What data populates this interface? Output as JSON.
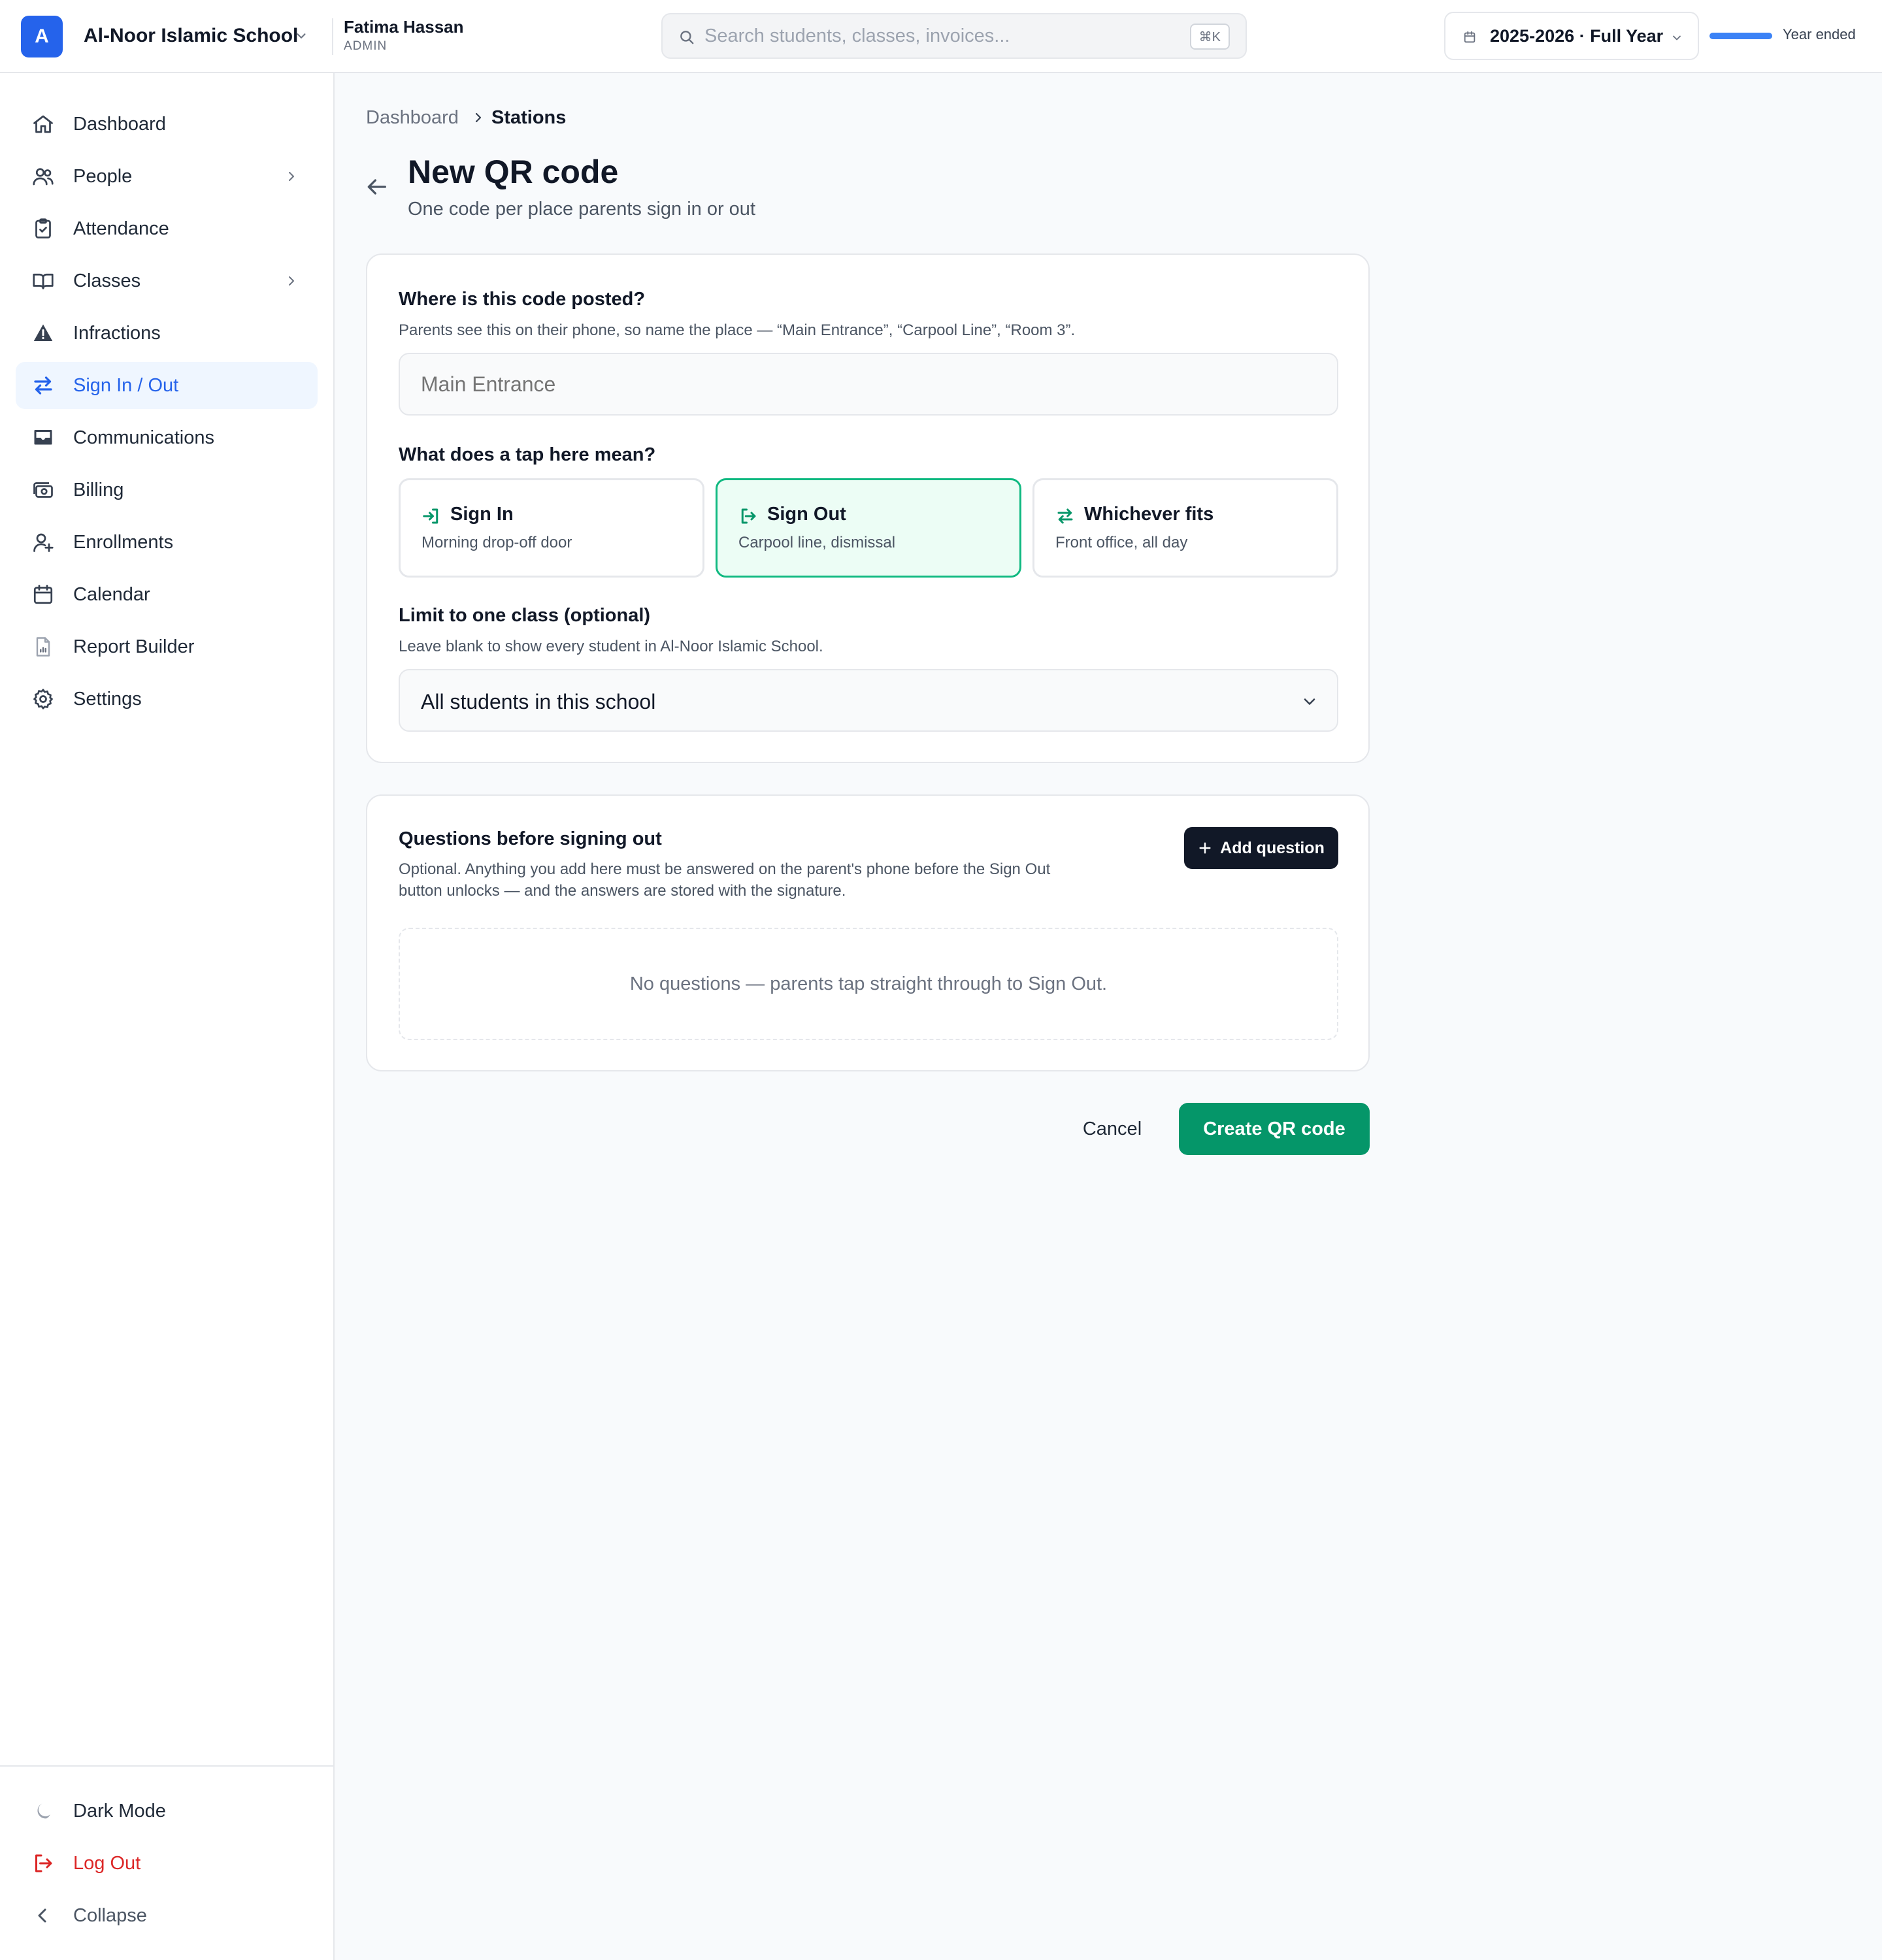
{
  "header": {
    "logo_letter": "A",
    "school_name": "Al-Noor Islamic School",
    "user_name": "Fatima Hassan",
    "user_role": "ADMIN",
    "search_placeholder": "Search students, classes, invoices...",
    "search_shortcut": "⌘K",
    "year_label": "2025-2026 · Full Year",
    "year_status": "Year ended",
    "year_progress_percent": 100,
    "accent_color": "#2563eb"
  },
  "sidebar": {
    "items": [
      {
        "label": "Dashboard",
        "icon": "home-icon"
      },
      {
        "label": "People",
        "icon": "users-icon",
        "has_children": true
      },
      {
        "label": "Attendance",
        "icon": "clipboard-check-icon"
      },
      {
        "label": "Classes",
        "icon": "book-open-icon",
        "has_children": true
      },
      {
        "label": "Infractions",
        "icon": "warning-icon"
      },
      {
        "label": "Sign In / Out",
        "icon": "arrows-exchange-icon",
        "active": true
      },
      {
        "label": "Communications",
        "icon": "inbox-icon"
      },
      {
        "label": "Billing",
        "icon": "money-icon"
      },
      {
        "label": "Enrollments",
        "icon": "user-plus-icon"
      },
      {
        "label": "Calendar",
        "icon": "calendar-icon"
      },
      {
        "label": "Report Builder",
        "icon": "report-icon"
      },
      {
        "label": "Settings",
        "icon": "gear-icon"
      }
    ],
    "bottom": {
      "dark_mode": "Dark Mode",
      "logout": "Log Out",
      "collapse": "Collapse"
    }
  },
  "breadcrumb": {
    "parent": "Dashboard",
    "current": "Stations"
  },
  "page": {
    "title": "New QR code",
    "subtitle": "One code per place parents sign in or out"
  },
  "form": {
    "location_label": "Where is this code posted?",
    "location_hint": "Parents see this on their phone, so name the place — “Main Entrance”, “Carpool Line”, “Room 3”.",
    "location_placeholder": "Main Entrance",
    "tap_label": "What does a tap here mean?",
    "options": [
      {
        "title": "Sign In",
        "desc": "Morning drop-off door",
        "icon": "sign-in-icon"
      },
      {
        "title": "Sign Out",
        "desc": "Carpool line, dismissal",
        "icon": "sign-out-icon",
        "selected": true
      },
      {
        "title": "Whichever fits",
        "desc": "Front office, all day",
        "icon": "arrows-exchange-icon"
      }
    ],
    "class_label": "Limit to one class (optional)",
    "class_hint": "Leave blank to show every student in Al-Noor Islamic School.",
    "class_value": "All students in this school"
  },
  "questions": {
    "title": "Questions before signing out",
    "hint": "Optional. Anything you add here must be answered on the parent's phone before the Sign Out button unlocks — and the answers are stored with the signature.",
    "add_label": "Add question",
    "empty_text": "No questions — parents tap straight through to Sign Out."
  },
  "actions": {
    "cancel": "Cancel",
    "create": "Create QR code",
    "create_color": "#059669"
  }
}
